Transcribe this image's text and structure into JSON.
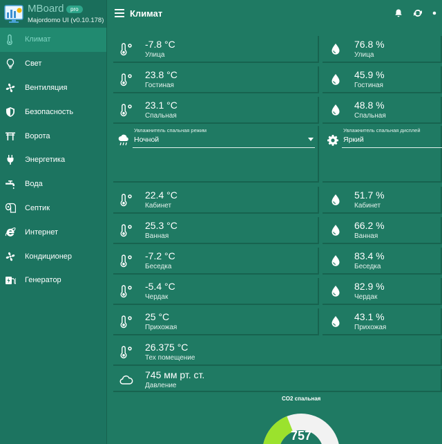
{
  "brand": {
    "title": "MBoard",
    "badge": "pro",
    "subtitle": "Majordomo UI (v0.10.178)"
  },
  "sidebar": {
    "items": [
      {
        "label": "Климат",
        "icon": "thermometer-icon",
        "active": true
      },
      {
        "label": "Свет",
        "icon": "lightbulb-icon"
      },
      {
        "label": "Вентиляция",
        "icon": "fan-icon"
      },
      {
        "label": "Безопасность",
        "icon": "shield-icon"
      },
      {
        "label": "Ворота",
        "icon": "gate-icon"
      },
      {
        "label": "Энергетика",
        "icon": "plug-icon"
      },
      {
        "label": "Вода",
        "icon": "faucet-icon"
      },
      {
        "label": "Септик",
        "icon": "toilet-paper-icon"
      },
      {
        "label": "Интернет",
        "icon": "internet-explorer-icon"
      },
      {
        "label": "Кондиционер",
        "icon": "fan-icon"
      },
      {
        "label": "Генератор",
        "icon": "generator-icon"
      }
    ]
  },
  "header": {
    "title": "Климат",
    "icons": [
      "bell-icon",
      "refresh-icon",
      "more-icon"
    ]
  },
  "temps_top": [
    {
      "value": "-7.8 °C",
      "label": "Улица"
    },
    {
      "value": "23.8 °C",
      "label": "Гостиная"
    },
    {
      "value": "23.1 °C",
      "label": "Спальная"
    }
  ],
  "hums_top": [
    {
      "value": "76.8 %",
      "label": "Улица"
    },
    {
      "value": "45.9 %",
      "label": "Гостиная"
    },
    {
      "value": "48.8 %",
      "label": "Спальная"
    }
  ],
  "selects": {
    "mode": {
      "label": "Увлажнитель спальная режим",
      "value": "Ночной"
    },
    "display": {
      "label": "Увлажнитель спальная дисплей",
      "value": "Яркий"
    }
  },
  "temps_bottom": [
    {
      "value": "22.4 °C",
      "label": "Кабинет"
    },
    {
      "value": "25.3 °C",
      "label": "Ванная"
    },
    {
      "value": "-7.2 °C",
      "label": "Беседка"
    },
    {
      "value": "-5.4 °C",
      "label": "Чердак"
    },
    {
      "value": "25 °C",
      "label": "Прихожая"
    },
    {
      "value": "26.375 °C",
      "label": "Тех помещение"
    }
  ],
  "hums_bottom": [
    {
      "value": "51.7 %",
      "label": "Кабинет"
    },
    {
      "value": "66.2 %",
      "label": "Ванная"
    },
    {
      "value": "83.4 %",
      "label": "Беседка"
    },
    {
      "value": "82.9 %",
      "label": "Чердак"
    },
    {
      "value": "43.1 %",
      "label": "Прихожая"
    }
  ],
  "pressure": {
    "value": "745 мм рт. ст.",
    "label": "Давление"
  },
  "co2": {
    "title": "CO2 спальная",
    "value": "757",
    "fraction": 0.38,
    "fill_color": "#9be22d",
    "track_color": "#f2f2f2"
  }
}
